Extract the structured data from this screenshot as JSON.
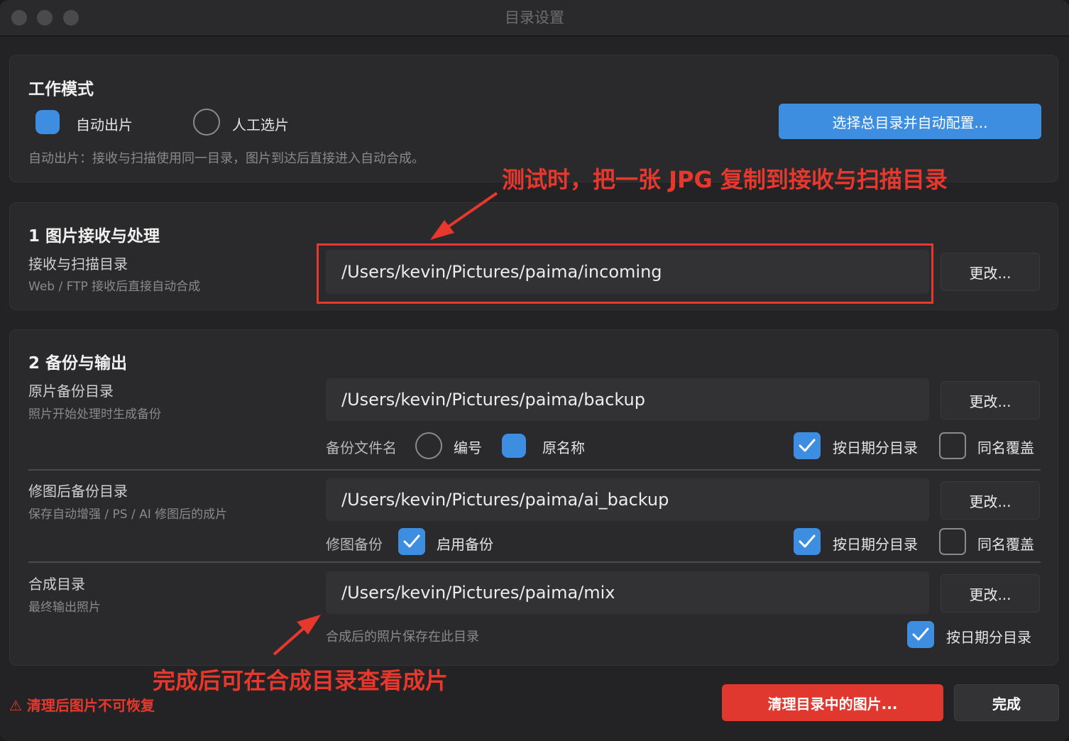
{
  "window": {
    "title": "目录设置"
  },
  "work_mode": {
    "title": "工作模式",
    "option_auto": "自动出片",
    "option_manual": "人工选片",
    "description": "自动出片：接收与扫描使用同一目录，图片到达后直接进入自动合成。",
    "auto_config_button": "选择总目录并自动配置..."
  },
  "section1": {
    "title": "1  图片接收与处理",
    "receive_label": "接收与扫描目录",
    "receive_sub": "Web / FTP 接收后直接自动合成",
    "receive_path": "/Users/kevin/Pictures/paima/incoming",
    "change_button": "更改..."
  },
  "section2": {
    "title": "2  备份与输出",
    "backup": {
      "label": "原片备份目录",
      "sub": "照片开始处理时生成备份",
      "path": "/Users/kevin/Pictures/paima/backup",
      "change_button": "更改...",
      "filename_label": "备份文件名",
      "option_number": "编号",
      "option_original": "原名称",
      "by_date": "按日期分目录",
      "overwrite": "同名覆盖"
    },
    "retouch": {
      "label": "修图后备份目录",
      "sub": "保存自动增强 / PS / AI 修图后的成片",
      "path": "/Users/kevin/Pictures/paima/ai_backup",
      "change_button": "更改...",
      "backup_label": "修图备份",
      "enable": "启用备份",
      "by_date": "按日期分目录",
      "overwrite": "同名覆盖"
    },
    "mix": {
      "label": "合成目录",
      "sub": "最终输出照片",
      "path": "/Users/kevin/Pictures/paima/mix",
      "change_button": "更改...",
      "note": "合成后的照片保存在此目录",
      "by_date": "按日期分目录"
    }
  },
  "footer": {
    "warning": "⚠ 清理后图片不可恢复",
    "clean_button": "清理目录中的图片...",
    "done_button": "完成"
  },
  "annotations": {
    "top": "测试时，把一张 JPG 复制到接收与扫描目录",
    "bottom": "完成后可在合成目录查看成片"
  },
  "colors": {
    "accent_blue": "#3d8de0",
    "danger_red": "#e8372c",
    "annotation_red": "#e8372c"
  }
}
